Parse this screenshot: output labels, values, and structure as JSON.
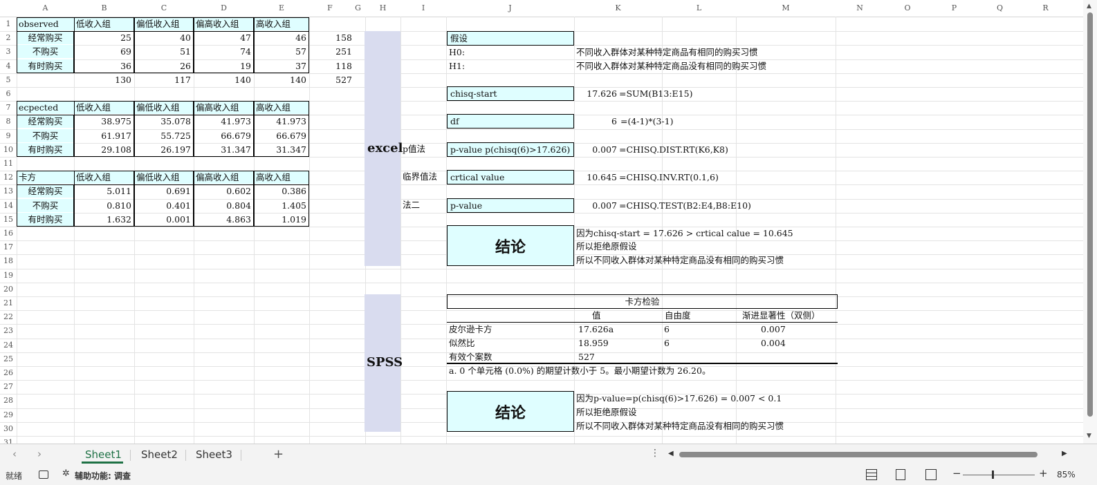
{
  "columns": [
    "A",
    "B",
    "C",
    "D",
    "E",
    "F",
    "G",
    "H",
    "I",
    "J",
    "K",
    "L",
    "M",
    "N",
    "O",
    "P",
    "Q",
    "R"
  ],
  "rows": [
    "1",
    "2",
    "3",
    "4",
    "5",
    "6",
    "7",
    "8",
    "9",
    "10",
    "11",
    "12",
    "13",
    "14",
    "15",
    "16",
    "17",
    "18",
    "19",
    "20",
    "21",
    "22",
    "23",
    "24",
    "25",
    "26",
    "27",
    "28",
    "29",
    "30",
    "31"
  ],
  "observed": {
    "header": [
      "observed",
      "低收入组",
      "偏低收入组",
      "偏高收入组",
      "高收入组"
    ],
    "rows": [
      [
        "经常购买",
        "25",
        "40",
        "47",
        "46",
        "158"
      ],
      [
        "不购买",
        "69",
        "51",
        "74",
        "57",
        "251"
      ],
      [
        "有时购买",
        "36",
        "26",
        "19",
        "37",
        "118"
      ]
    ],
    "totals": [
      "130",
      "117",
      "140",
      "140",
      "527"
    ]
  },
  "expected": {
    "header": [
      "ecpected",
      "低收入组",
      "偏低收入组",
      "偏高收入组",
      "高收入组"
    ],
    "rows": [
      [
        "经常购买",
        "38.975",
        "35.078",
        "41.973",
        "41.973"
      ],
      [
        "不购买",
        "61.917",
        "55.725",
        "66.679",
        "66.679"
      ],
      [
        "有时购买",
        "29.108",
        "26.197",
        "31.347",
        "31.347"
      ]
    ]
  },
  "chisq": {
    "header": [
      "卡方",
      "低收入组",
      "偏低收入组",
      "偏高收入组",
      "高收入组"
    ],
    "rows": [
      [
        "经常购买",
        "5.011",
        "0.691",
        "0.602",
        "0.386"
      ],
      [
        "不购买",
        "0.810",
        "0.401",
        "0.804",
        "1.405"
      ],
      [
        "有时购买",
        "1.632",
        "0.001",
        "4.863",
        "1.019"
      ]
    ]
  },
  "excel_panel": {
    "label": "excel",
    "hypothesis_title": "假设",
    "h0_label": "H0:",
    "h0_text": "不同收入群体对某种特定商品有相同的购买习惯",
    "h1_label": "H1:",
    "h1_text": "不同收入群体对某种特定商品没有相同的购买习惯",
    "chisq_start_label": "chisq-start",
    "chisq_start_value": "17.626",
    "chisq_start_formula": "=SUM(B13:E15)",
    "df_label": "df",
    "df_value": "6",
    "df_formula": "=(4-1)*(3-1)",
    "pvalue_method": "p值法",
    "pvalue_label": "p-value  p(chisq(6)>17.626)",
    "pvalue_value": "0.007",
    "pvalue_formula": "=CHISQ.DIST.RT(K6,K8)",
    "critical_method": "临界值法",
    "critical_label": "crtical value",
    "critical_value": "10.645",
    "critical_formula": "=CHISQ.INV.RT(0.1,6)",
    "method2": "法二",
    "pvalue2_label": "p-value",
    "pvalue2_value": "0.007",
    "pvalue2_formula": "=CHISQ.TEST(B2:E4,B8:E10)",
    "conclusion_title": "结论",
    "conclusion_lines": [
      "因为chisq-start = 17.626 > crtical calue = 10.645",
      "所以拒绝原假设",
      "所以不同收入群体对某种特定商品没有相同的购买习惯"
    ]
  },
  "spss_panel": {
    "label": "SPSS",
    "table_title": "卡方检验",
    "col_headers": [
      "值",
      "自由度",
      "渐进显著性（双侧）"
    ],
    "rows": [
      [
        "皮尔逊卡方",
        "17.626a",
        "6",
        "0.007"
      ],
      [
        "似然比",
        "18.959",
        "6",
        "0.004"
      ],
      [
        "有效个案数",
        "527",
        "",
        ""
      ]
    ],
    "footnote": "a. 0 个单元格 (0.0%) 的期望计数小于 5。最小期望计数为 26.20。",
    "conclusion_title": "结论",
    "conclusion_lines": [
      "因为p-value=p(chisq(6)>17.626) = 0.007 < 0.1",
      "所以拒绝原假设",
      "所以不同收入群体对某种特定商品没有相同的购买习惯"
    ]
  },
  "tabs": [
    "Sheet1",
    "Sheet2",
    "Sheet3"
  ],
  "active_tab": "Sheet1",
  "add_tab": "+",
  "status": {
    "ready": "就绪",
    "accessibility": "辅助功能: 调查",
    "zoom": "85%",
    "zoom_level": 0.85
  },
  "colors": {
    "cyan": "#dffeff",
    "lavender": "#d9dcef",
    "tab_underline": "#1e7145"
  }
}
